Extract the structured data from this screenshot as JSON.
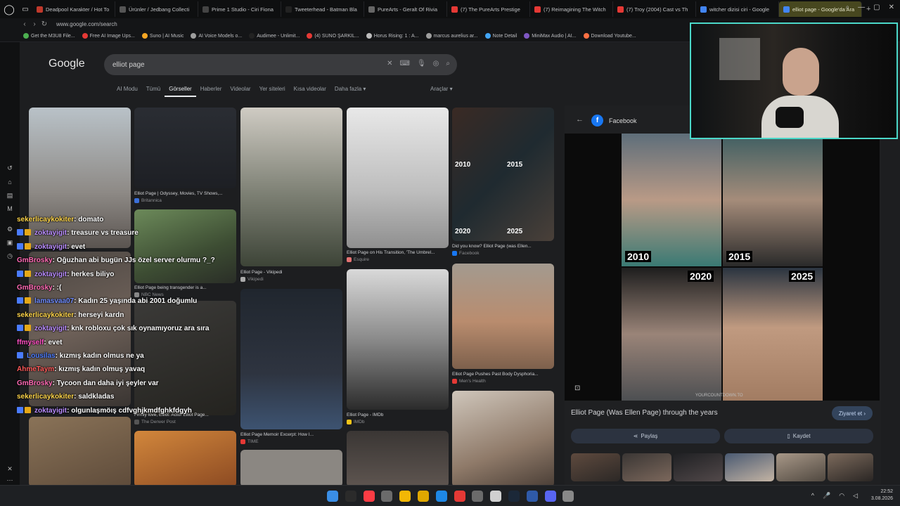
{
  "browser": {
    "tabs": [
      {
        "label": "Deadpool Karakter / Hot To",
        "color": "#c0392b"
      },
      {
        "label": "Ürünler / Jedbang Collecti",
        "color": "#555555"
      },
      {
        "label": "Prime 1 Studio - Ciri Fiona",
        "color": "#444444"
      },
      {
        "label": "Tweeterhead - Batman Bla",
        "color": "#222222"
      },
      {
        "label": "PureArts - Geralt Of Rivia",
        "color": "#666666"
      },
      {
        "label": "(7) The PureArts Prestige",
        "color": "#e53935"
      },
      {
        "label": "(7) Reimagining The Witch",
        "color": "#e53935"
      },
      {
        "label": "(7) Troy (2004) Cast vs Th",
        "color": "#e53935"
      },
      {
        "label": "witcher dizisi ciri - Google",
        "color": "#4285f4"
      },
      {
        "label": "elliot page - Google'da Ara",
        "color": "#4285f4"
      }
    ],
    "tab_new": "+",
    "url": "www.google.com/search",
    "bookmarks": [
      {
        "label": "Get the M3U8 File...",
        "color": "#4caf50"
      },
      {
        "label": "Free AI Image Ups...",
        "color": "#e53935"
      },
      {
        "label": "Suno | AI Music",
        "color": "#f5a623"
      },
      {
        "label": "AI Voice Models o...",
        "color": "#9e9e9e"
      },
      {
        "label": "Audimee - Unlimit...",
        "color": "#222222"
      },
      {
        "label": "(4) SUNO ŞARKIL...",
        "color": "#e53935"
      },
      {
        "label": "Horus Rising: 1 : A...",
        "color": "#bdbdbd"
      },
      {
        "label": "marcus aurelius ar...",
        "color": "#9e9e9e"
      },
      {
        "label": "Note Detail",
        "color": "#42a5f5"
      },
      {
        "label": "MiniMax Audio | AI...",
        "color": "#7e57c2"
      },
      {
        "label": "Download Youtube...",
        "color": "#ff7043"
      }
    ]
  },
  "google": {
    "logo": "Google",
    "query": "elliot page",
    "tabs": [
      "AI Modu",
      "Tümü",
      "Görseller",
      "Haberler",
      "Videolar",
      "Yer siteleri",
      "Kısa videolar",
      "Daha fazla ▾"
    ],
    "active_tab": "Görseller",
    "tools": "Araçlar ▾"
  },
  "results": [
    {
      "caption": "Elliot Page | Odyssey, Movies, TV Shows,...",
      "source": "Britannica"
    },
    {
      "caption": "Elliot Page - Vikipedi",
      "source": "Vikipedi"
    },
    {
      "caption": "Elliot Page on His Transition, 'The Umbrel...",
      "source": "Esquire"
    },
    {
      "caption": "Did you know? Elliot Page (was Ellen...",
      "source": "Facebook"
    },
    {
      "caption": "Elliot Page on His Transition, 'The Umbrel...",
      "source": ""
    },
    {
      "caption": "Elliot Page being transgender is a...",
      "source": "NBC News"
    },
    {
      "caption": "Elliot Page - IMDb",
      "source": "IMDb"
    },
    {
      "caption": "Elliot Page Pushes Past Body Dysphoria...",
      "source": "Men's Health"
    },
    {
      "caption": "Elliot Page Memoir Excerpt: How I...",
      "source": "TIME"
    },
    {
      "caption": "Firmly love, Elliot: Actor Elliot Page...",
      "source": "The Denver Post"
    }
  ],
  "year_labels": [
    "2010",
    "2015",
    "2020",
    "2025"
  ],
  "panel": {
    "source": "Facebook",
    "title": "Elliot Page (Was Ellen Page) through the years",
    "visit": "Ziyaret et ›",
    "share": "Paylaş",
    "save": "Kaydet",
    "watermark": "YOURCOUNTDOWN.TO"
  },
  "chat": [
    {
      "user": "sekerlicaykokiter",
      "color": "#ffd54a",
      "text": ": domato",
      "badges": []
    },
    {
      "user": "zoktayigit",
      "color": "#b98cff",
      "text": ": treasure vs treasure",
      "badges": [
        "#4a7cff",
        "#e6a817"
      ]
    },
    {
      "user": "zoktayigit",
      "color": "#b98cff",
      "text": ": evet",
      "badges": [
        "#4a7cff",
        "#e6a817"
      ]
    },
    {
      "user": "GmBrosky",
      "color": "#ff69b4",
      "text": ": Oğuzhan abi bugün JJs özel server olurmu ?_?",
      "badges": []
    },
    {
      "user": "zoktayigit",
      "color": "#b98cff",
      "text": ": herkes biliyo",
      "badges": [
        "#4a7cff",
        "#e6a817"
      ]
    },
    {
      "user": "GmBrosky",
      "color": "#ff69b4",
      "text": ": :(",
      "badges": []
    },
    {
      "user": "lamasvaa07",
      "color": "#6f8cff",
      "text": ": Kadın 25 yaşında abi 2001 doğumlu",
      "badges": [
        "#4a7cff",
        "#e6a817"
      ]
    },
    {
      "user": "sekerlicaykokiter",
      "color": "#ffd54a",
      "text": ": herseyi kardn",
      "badges": []
    },
    {
      "user": "zoktayigit",
      "color": "#b98cff",
      "text": ": knk robloxu çok sık oynamıyoruz ara sıra",
      "badges": [
        "#4a7cff",
        "#e6a817"
      ]
    },
    {
      "user": "ffmyself",
      "color": "#ff4fc3",
      "text": ": evet",
      "badges": []
    },
    {
      "user": "Lousilas",
      "color": "#4d7dff",
      "text": ": kızmış kadın olmus ne ya",
      "badges": [
        "#4a7cff"
      ]
    },
    {
      "user": "AhmeTaym",
      "color": "#ff5a5a",
      "text": ": kızmış kadın olmuş yavaq",
      "badges": []
    },
    {
      "user": "GmBrosky",
      "color": "#ff69b4",
      "text": ": Tycoon dan daha iyi şeyler var",
      "badges": []
    },
    {
      "user": "sekerlicaykokiter",
      "color": "#ffd54a",
      "text": ": saldkladas",
      "badges": []
    },
    {
      "user": "zoktayigit",
      "color": "#b98cff",
      "text": ": olgunlaşmöış cdfvghjkmdfghkfdgyh",
      "badges": [
        "#4a7cff",
        "#e6a817"
      ]
    }
  ],
  "taskbar": {
    "apps": [
      "start",
      "search",
      "music",
      "settings",
      "files",
      "folder",
      "mail",
      "opera",
      "app-bee",
      "media",
      "steam",
      "ai-app",
      "discord",
      "network"
    ],
    "time": "22:52",
    "date": "3.08.2026"
  },
  "colors": {
    "accent": "#4bd8c9",
    "active_tab": "#47471f",
    "page_bg": "#1d1e20"
  }
}
